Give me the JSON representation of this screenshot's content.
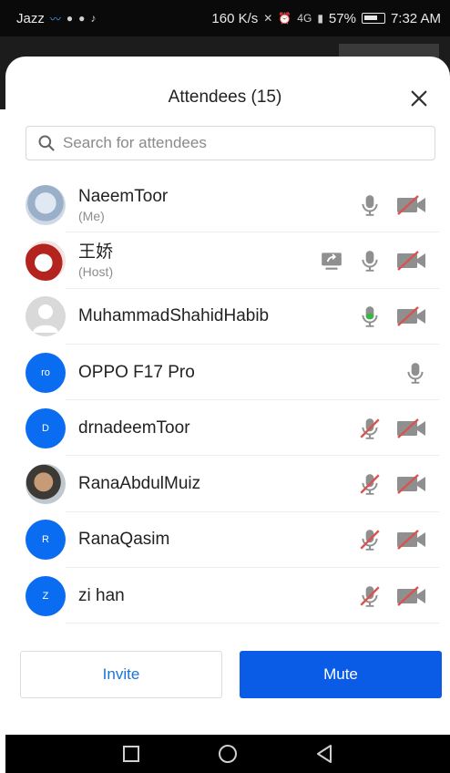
{
  "status_bar": {
    "carrier": "Jazz",
    "net_speed": "160 K/s",
    "signal_label": "4G",
    "battery": "57%",
    "time": "7:32 AM"
  },
  "sheet": {
    "title": "Attendees (15)",
    "search_placeholder": "Search for attendees"
  },
  "attendees": [
    {
      "name": "NaeemToor",
      "role": "(Me)",
      "avatar": "",
      "mic": "muted-gray",
      "camera": "off",
      "share": false
    },
    {
      "name": "王娇",
      "role": "(Host)",
      "avatar": "",
      "mic": "muted-gray",
      "camera": "off",
      "share": true
    },
    {
      "name": "MuhammadShahidHabib",
      "role": "",
      "avatar": "",
      "mic": "active-green",
      "camera": "off",
      "share": false
    },
    {
      "name": "OPPO F17 Pro",
      "role": "",
      "avatar": "ro",
      "mic": "muted-gray",
      "camera": "none",
      "share": false
    },
    {
      "name": "drnadeemToor",
      "role": "",
      "avatar": "D",
      "mic": "muted-red",
      "camera": "off",
      "share": false
    },
    {
      "name": "RanaAbdulMuiz",
      "role": "",
      "avatar": "",
      "mic": "muted-red",
      "camera": "off",
      "share": false
    },
    {
      "name": "RanaQasim",
      "role": "",
      "avatar": "R",
      "mic": "muted-red",
      "camera": "off",
      "share": false
    },
    {
      "name": "zi han",
      "role": "",
      "avatar": "Z",
      "mic": "muted-red",
      "camera": "off",
      "share": false
    }
  ],
  "actions": {
    "invite_label": "Invite",
    "mute_label": "Mute"
  },
  "colors": {
    "primary": "#0a5be6",
    "invite_text": "#1a73d9",
    "mic_green": "#3bb54a",
    "mute_red": "#d9534f",
    "icon_gray": "#8f8f8f"
  }
}
